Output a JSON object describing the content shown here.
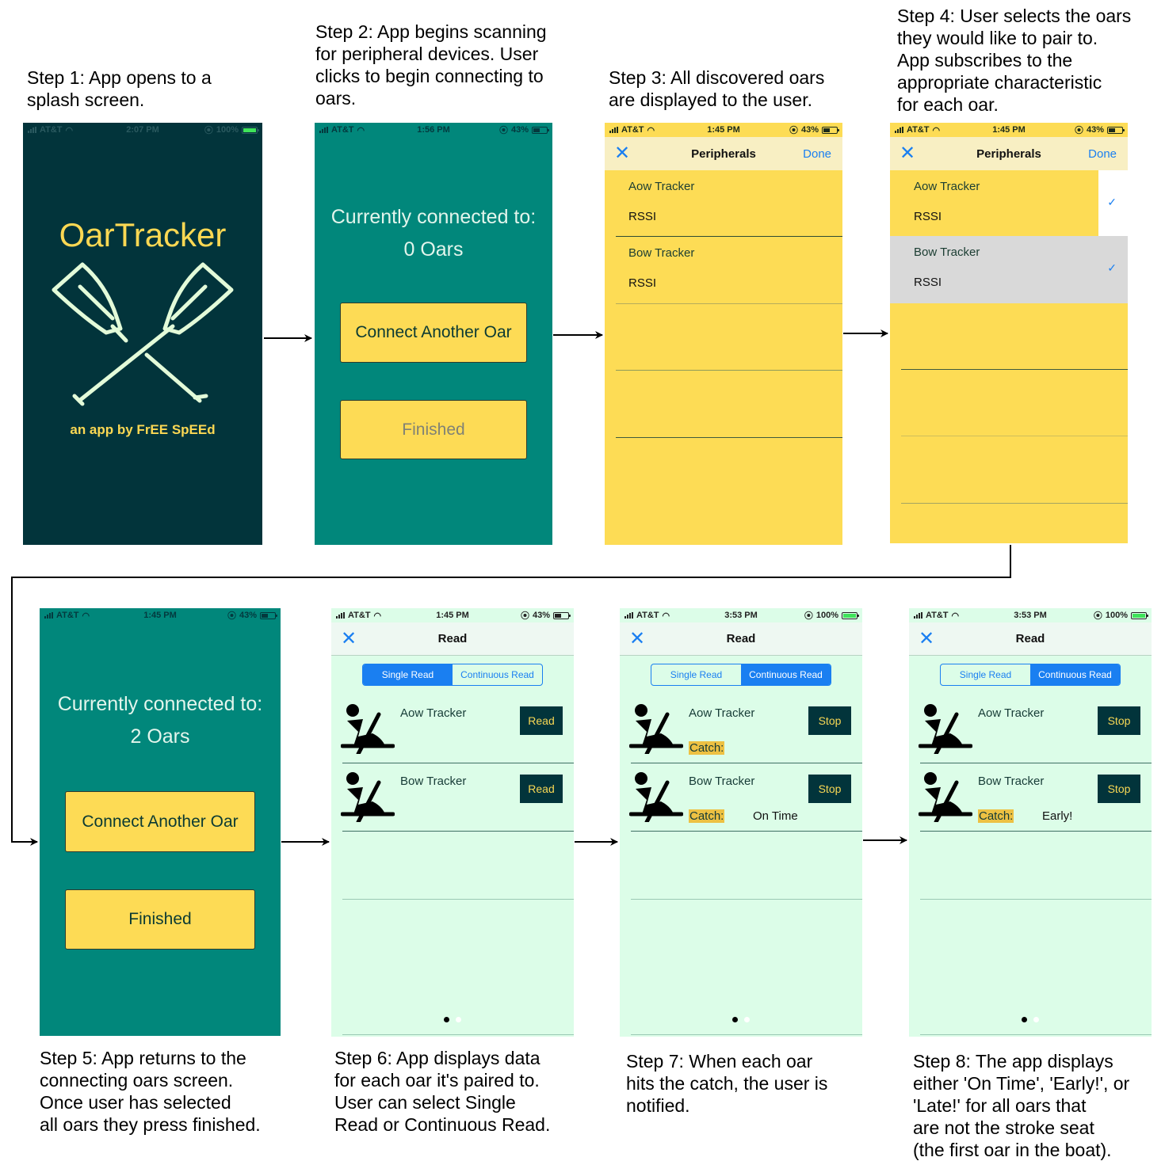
{
  "captions": {
    "step1": "Step 1: App opens to a\nsplash screen.",
    "step2": "Step 2: App begins scanning\nfor peripheral devices. User\nclicks to begin connecting to\noars.",
    "step3": "Step 3: All discovered oars\nare displayed to the user.",
    "step4": "Step 4: User selects the oars\nthey would like to pair to.\nApp subscribes to the\nappropriate characteristic\nfor each oar.",
    "step5": "Step 5: App returns to the\nconnecting oars screen.\nOnce user has selected\nall oars they press finished.",
    "step6": "Step 6: App displays data\nfor each oar it's paired to.\nUser can select Single\nRead or Continuous Read.",
    "step7": "Step 7: When each oar\nhits the catch, the user is\nnotified.",
    "step8": "Step 8: The app displays\neither 'On Time', 'Early!', or\n'Late!' for all oars that\nare not the stroke seat\n(the first oar in the boat)."
  },
  "colors": {
    "splash_bg": "#02343b",
    "teal_bg": "#01877b",
    "yellow": "#fddc55",
    "mint_bg": "#dcfde8",
    "ios_blue": "#1a7ff1",
    "catch_highlight": "#edc143",
    "oar_icon": "#e3fbd9"
  },
  "screens": {
    "s1": {
      "status": {
        "carrier": "AT&T",
        "time": "2:07 PM",
        "battery": "100%",
        "battery_level": 1.0
      },
      "title": "OarTracker",
      "subtitle": "an app by FrEE SpEEd",
      "icon": "crossed-oars-icon"
    },
    "s2": {
      "status": {
        "carrier": "AT&T",
        "time": "1:56 PM",
        "battery": "43%",
        "battery_level": 0.43
      },
      "line1": "Currently connected to:",
      "line2": "0 Oars",
      "connect_label": "Connect Another Oar",
      "finished_label": "Finished"
    },
    "s3": {
      "status": {
        "carrier": "AT&T",
        "time": "1:45 PM",
        "battery": "43%",
        "battery_level": 0.43
      },
      "nav_title": "Peripherals",
      "done_label": "Done",
      "peripherals": [
        {
          "name": "Aow Tracker",
          "rssi": "RSSI"
        },
        {
          "name": "Bow Tracker",
          "rssi": "RSSI"
        }
      ]
    },
    "s4": {
      "status": {
        "carrier": "AT&T",
        "time": "1:45 PM",
        "battery": "43%",
        "battery_level": 0.43
      },
      "nav_title": "Peripherals",
      "done_label": "Done",
      "peripherals": [
        {
          "name": "Aow Tracker",
          "rssi": "RSSI",
          "checked": true,
          "check": "✓"
        },
        {
          "name": "Bow Tracker",
          "rssi": "RSSI",
          "checked": true,
          "check": "✓"
        }
      ]
    },
    "s5": {
      "status": {
        "carrier": "AT&T",
        "time": "1:45 PM",
        "battery": "43%",
        "battery_level": 0.43
      },
      "line1": "Currently connected to:",
      "line2": "2 Oars",
      "connect_label": "Connect Another Oar",
      "finished_label": "Finished"
    },
    "s6": {
      "status": {
        "carrier": "AT&T",
        "time": "1:45 PM",
        "battery": "43%",
        "battery_level": 0.43
      },
      "nav_title": "Read",
      "segments": [
        "Single Read",
        "Continuous Read"
      ],
      "active_segment": 0,
      "oars": [
        {
          "name": "Aow Tracker",
          "button": "Read",
          "catch": "",
          "result": ""
        },
        {
          "name": "Bow Tracker",
          "button": "Read",
          "catch": "",
          "result": ""
        }
      ],
      "page": 1,
      "pages": 2
    },
    "s7": {
      "status": {
        "carrier": "AT&T",
        "time": "3:53 PM",
        "battery": "100%",
        "battery_level": 1.0
      },
      "nav_title": "Read",
      "segments": [
        "Single Read",
        "Continuous Read"
      ],
      "active_segment": 1,
      "oars": [
        {
          "name": "Aow Tracker",
          "button": "Stop",
          "catch": "Catch:",
          "result": ""
        },
        {
          "name": "Bow Tracker",
          "button": "Stop",
          "catch": "Catch:",
          "result": "On Time"
        }
      ],
      "page": 1,
      "pages": 2
    },
    "s8": {
      "status": {
        "carrier": "AT&T",
        "time": "3:53 PM",
        "battery": "100%",
        "battery_level": 1.0
      },
      "nav_title": "Read",
      "segments": [
        "Single Read",
        "Continuous Read"
      ],
      "active_segment": 1,
      "oars": [
        {
          "name": "Aow Tracker",
          "button": "Stop",
          "catch": "",
          "result": ""
        },
        {
          "name": "Bow Tracker",
          "button": "Stop",
          "catch": "Catch:",
          "result": "Early!"
        }
      ],
      "page": 1,
      "pages": 2
    }
  }
}
